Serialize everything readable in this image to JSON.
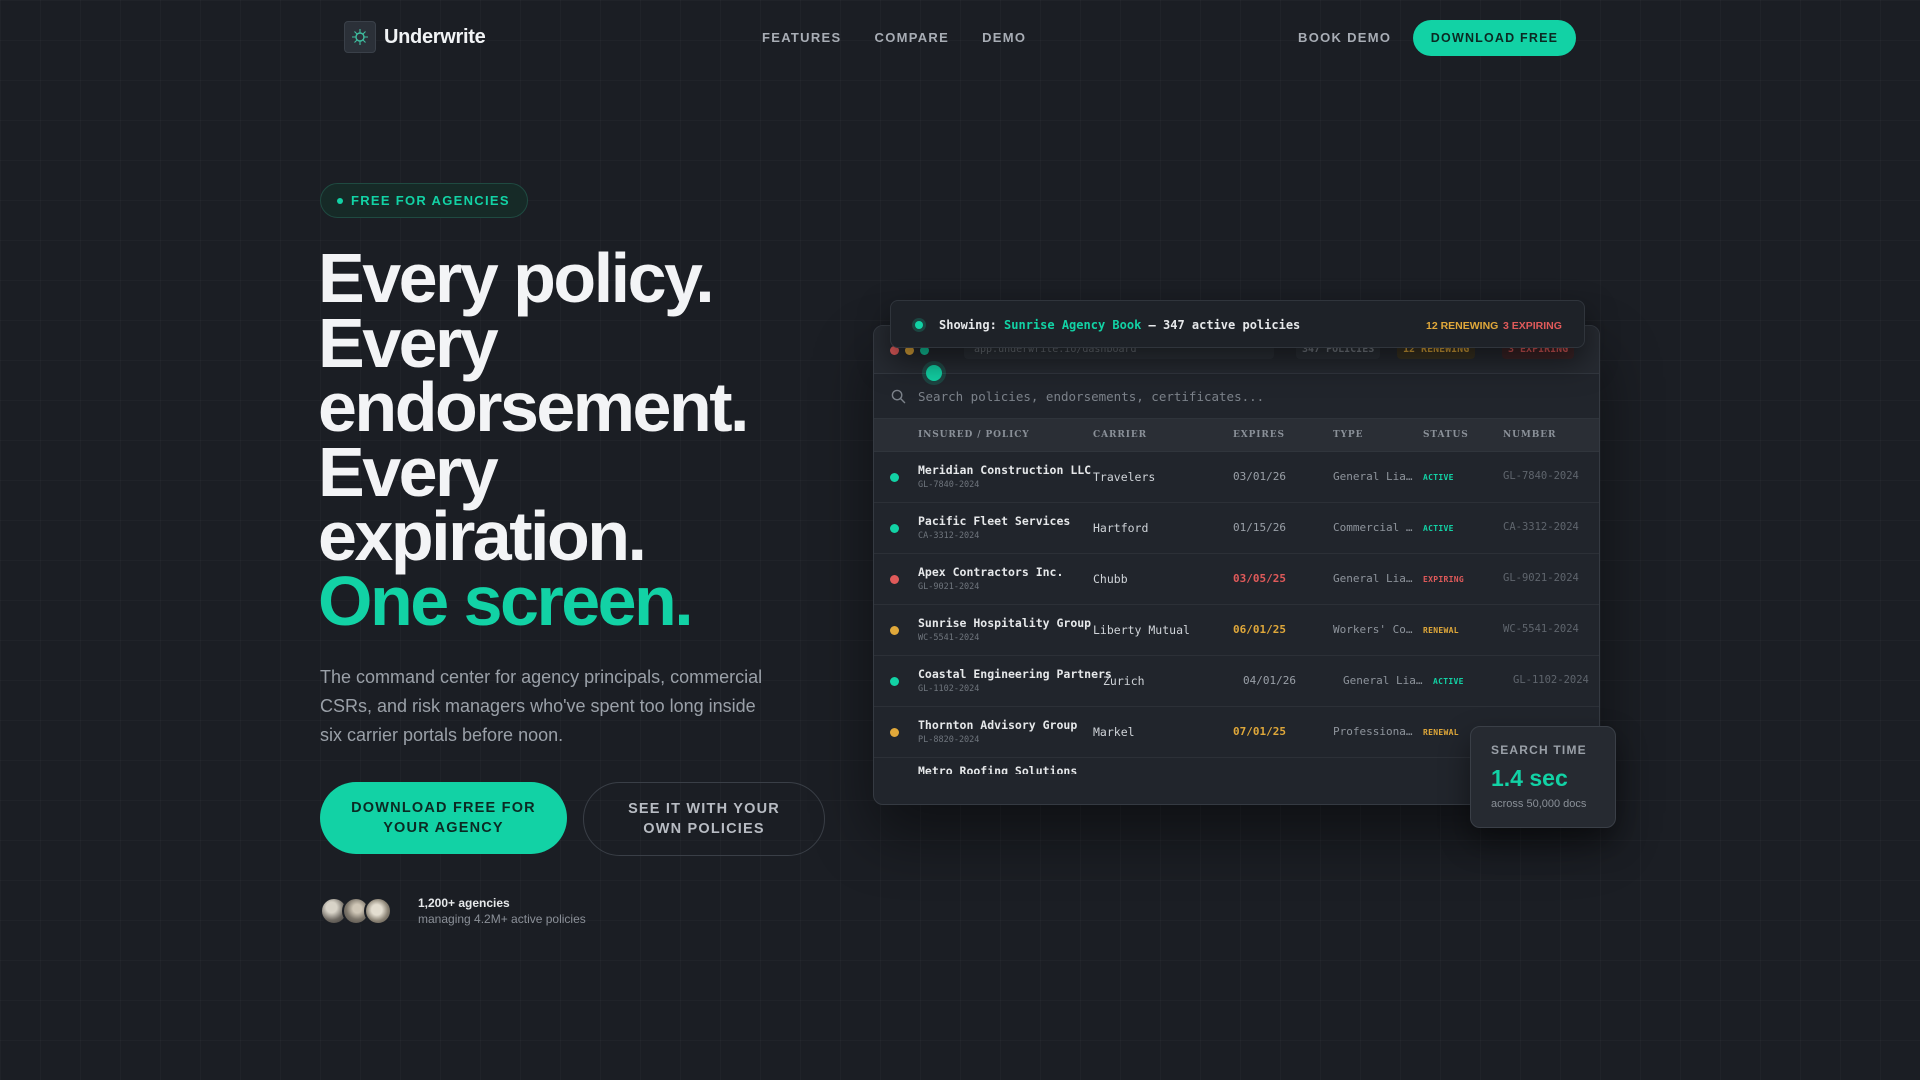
{
  "nav": {
    "brand": "Underwrite",
    "links": [
      "FEATURES",
      "COMPARE",
      "DEMO"
    ],
    "book_demo": "BOOK DEMO",
    "download": "DOWNLOAD FREE"
  },
  "hero": {
    "badge": "FREE FOR AGENCIES",
    "headline": [
      "Every policy.",
      "Every",
      "endorsement.",
      "Every",
      "expiration."
    ],
    "headline_accent": "One screen.",
    "subtitle": "The command center for agency principals, commercial CSRs, and risk managers who've spent too long inside six carrier portals before noon.",
    "cta_primary": "DOWNLOAD FREE FOR YOUR AGENCY",
    "cta_secondary": "SEE IT WITH YOUR OWN POLICIES",
    "proof_main": "1,200+ agencies",
    "proof_sub": "managing 4.2M+ active policies"
  },
  "dashboard": {
    "url": "app.underwrite.io/dashboard",
    "pills": {
      "policies": "347 POLICIES",
      "renewing": "12 RENEWING",
      "expiring": "3 EXPIRING"
    },
    "search_placeholder": "Search policies, endorsements, certificates...",
    "columns": [
      "INSURED / POLICY",
      "CARRIER",
      "EXPIRES",
      "TYPE",
      "STATUS",
      "NUMBER"
    ],
    "rows": [
      {
        "name": "Meridian Construction LLC",
        "policy": "GL-7840-2024",
        "carrier": "Travelers",
        "expires": "03/01/26",
        "type": "General Liability",
        "status": "ACTIVE",
        "number": "GL-7840-2024",
        "level": "active"
      },
      {
        "name": "Pacific Fleet Services",
        "policy": "CA-3312-2024",
        "carrier": "Hartford",
        "expires": "01/15/26",
        "type": "Commercial Auto",
        "status": "ACTIVE",
        "number": "CA-3312-2024",
        "level": "active"
      },
      {
        "name": "Apex Contractors Inc.",
        "policy": "GL-9021-2024",
        "carrier": "Chubb",
        "expires": "03/05/25",
        "type": "General Liability",
        "status": "EXPIRING",
        "number": "GL-9021-2024",
        "level": "expiring"
      },
      {
        "name": "Sunrise Hospitality Group",
        "policy": "WC-5541-2024",
        "carrier": "Liberty Mutual",
        "expires": "06/01/25",
        "type": "Workers' Comp",
        "status": "RENEWAL",
        "number": "WC-5541-2024",
        "level": "renewal"
      },
      {
        "name": "Coastal Engineering Partners",
        "policy": "GL-1102-2024",
        "carrier": "Zurich",
        "expires": "04/01/26",
        "type": "General Liability",
        "status": "ACTIVE",
        "number": "GL-1102-2024",
        "level": "active"
      },
      {
        "name": "Thornton Advisory Group",
        "policy": "PL-8820-2024",
        "carrier": "Markel",
        "expires": "07/01/25",
        "type": "Professional Liability",
        "status": "RENEWAL",
        "number": "PL-8820-2024",
        "level": "renewal"
      }
    ],
    "partial_row": "Metro Roofing Solutions"
  },
  "showing": {
    "label": "Showing:",
    "book": "Sunrise Agency Book",
    "rest": "— 347 active policies",
    "renewing": "12 RENEWING",
    "expiring": "3 EXPIRING"
  },
  "search_time": {
    "label": "SEARCH TIME",
    "value": "1.4 sec",
    "sub": "across 50,000 docs"
  },
  "colors": {
    "accent": "#12d2a5",
    "renewal": "#e0a83a",
    "expiring": "#e05a5a",
    "background": "#1b1e24"
  }
}
